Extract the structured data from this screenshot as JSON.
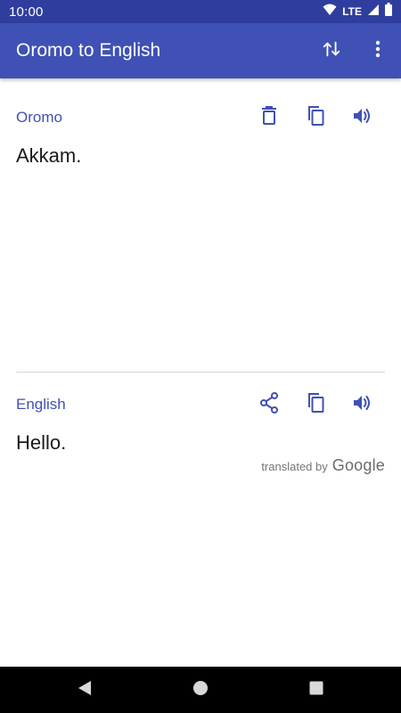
{
  "status_bar": {
    "time": "10:00",
    "network": "LTE",
    "icons": [
      "wifi-icon",
      "signal-icon",
      "battery-icon"
    ]
  },
  "app_bar": {
    "title": "Oromo to English",
    "actions": [
      "swap-languages-icon",
      "more-vert-icon"
    ],
    "color": "#3f51b5"
  },
  "source": {
    "language": "Oromo",
    "text": "Akkam.",
    "actions": [
      "delete-icon",
      "copy-icon",
      "speaker-icon"
    ]
  },
  "target": {
    "language": "English",
    "text": "Hello.",
    "actions": [
      "share-icon",
      "copy-icon",
      "speaker-icon"
    ],
    "attribution_prefix": "translated by",
    "attribution_brand": "Google"
  },
  "nav_bar": {
    "buttons": [
      "back-icon",
      "home-icon",
      "recents-icon"
    ]
  },
  "colors": {
    "accent": "#3f51b5",
    "status_bar": "#2f3e9e",
    "text": "#1a1a1a"
  }
}
